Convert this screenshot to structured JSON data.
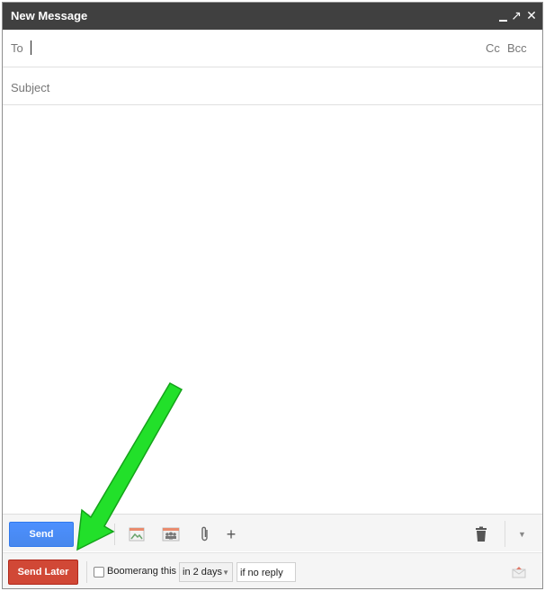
{
  "window": {
    "title": "New Message",
    "minimize_icon": "minimize-icon",
    "expand_glyph": "↗",
    "close_glyph": "✕"
  },
  "to": {
    "label": "To",
    "cc": "Cc",
    "bcc": "Bcc"
  },
  "subject": {
    "placeholder": "Subject",
    "value": ""
  },
  "toolbar": {
    "send_label": "Send",
    "icons": [
      "insert-photo-icon",
      "invite-people-icon",
      "attach-file-icon",
      "more-options-plus-icon",
      "discard-trash-icon",
      "more-dropdown-icon"
    ],
    "plus_glyph": "+",
    "clip_glyph": "⌇",
    "more_glyph": "▼"
  },
  "boomerang": {
    "send_later_label": "Send Later",
    "checkbox_label": "Boomerang this",
    "checked": false,
    "delay_value": "in 2 days",
    "condition_value": "if no reply",
    "select_arrow": "▼"
  },
  "colors": {
    "titlebar": "#404040",
    "send_blue": "#4d90fe",
    "send_later_red": "#d14836",
    "annotation_arrow": "#22e02a"
  }
}
